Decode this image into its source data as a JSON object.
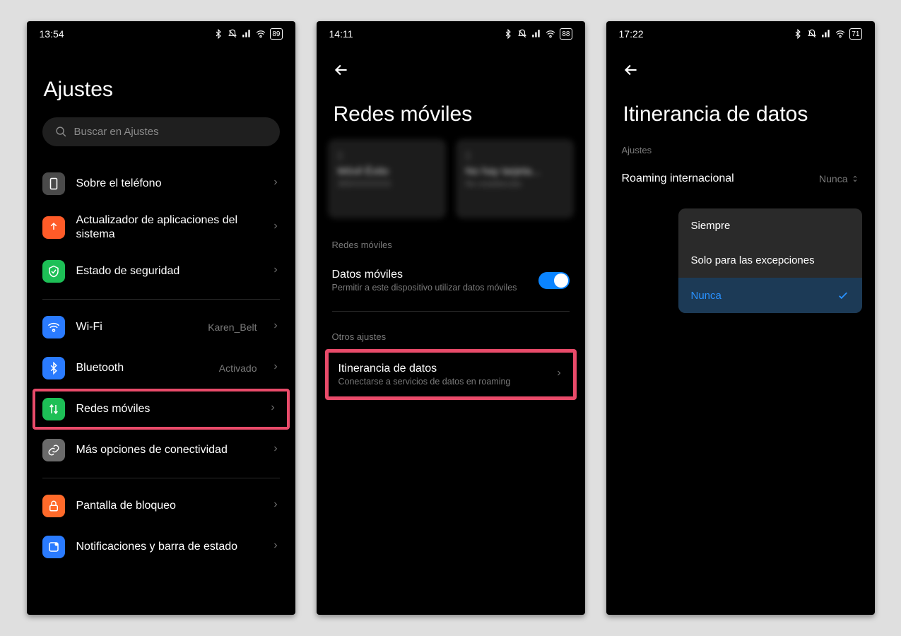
{
  "screen1": {
    "time": "13:54",
    "battery": "89",
    "title": "Ajustes",
    "search_placeholder": "Buscar en Ajustes",
    "items": [
      {
        "label": "Sobre el teléfono",
        "icon_name": "phone-info-icon",
        "color": "#4a4a4a"
      },
      {
        "label": "Actualizador de aplicaciones del sistema",
        "icon_name": "update-icon",
        "color": "#ff5b28"
      },
      {
        "label": "Estado de seguridad",
        "icon_name": "shield-icon",
        "color": "#1dbf56"
      }
    ],
    "network_items": [
      {
        "label": "Wi-Fi",
        "value": "Karen_Belt",
        "icon_name": "wifi-icon",
        "color": "#2a7bff"
      },
      {
        "label": "Bluetooth",
        "value": "Activado",
        "icon_name": "bluetooth-icon",
        "color": "#2a7bff"
      },
      {
        "label": "Redes móviles",
        "icon_name": "mobile-data-icon",
        "color": "#1dbf56",
        "highlighted": true
      },
      {
        "label": "Más opciones de conectividad",
        "icon_name": "link-icon",
        "color": "#6a6a6a"
      }
    ],
    "other_items": [
      {
        "label": "Pantalla de bloqueo",
        "icon_name": "lock-icon",
        "color": "#ff6a2a"
      },
      {
        "label": "Notificaciones y barra de estado",
        "icon_name": "notifications-icon",
        "color": "#2a7bff"
      }
    ]
  },
  "screen2": {
    "time": "14:11",
    "battery": "88",
    "title": "Redes móviles",
    "sim1": {
      "title": "Móvil Éxito",
      "sub": "305XXXXXXX"
    },
    "sim2": {
      "title": "No hay tarjeta...",
      "sub": "No establecido"
    },
    "section1": "Redes móviles",
    "mobile_data_label": "Datos móviles",
    "mobile_data_sub": "Permitir a este dispositivo utilizar datos móviles",
    "section2": "Otros ajustes",
    "roaming_label": "Itinerancia de datos",
    "roaming_sub": "Conectarse a servicios de datos en roaming"
  },
  "screen3": {
    "time": "17:22",
    "battery": "71",
    "title": "Itinerancia de datos",
    "section": "Ajustes",
    "row_label": "Roaming internacional",
    "row_value": "Nunca",
    "options": [
      "Siempre",
      "Solo para las excepciones",
      "Nunca"
    ]
  }
}
